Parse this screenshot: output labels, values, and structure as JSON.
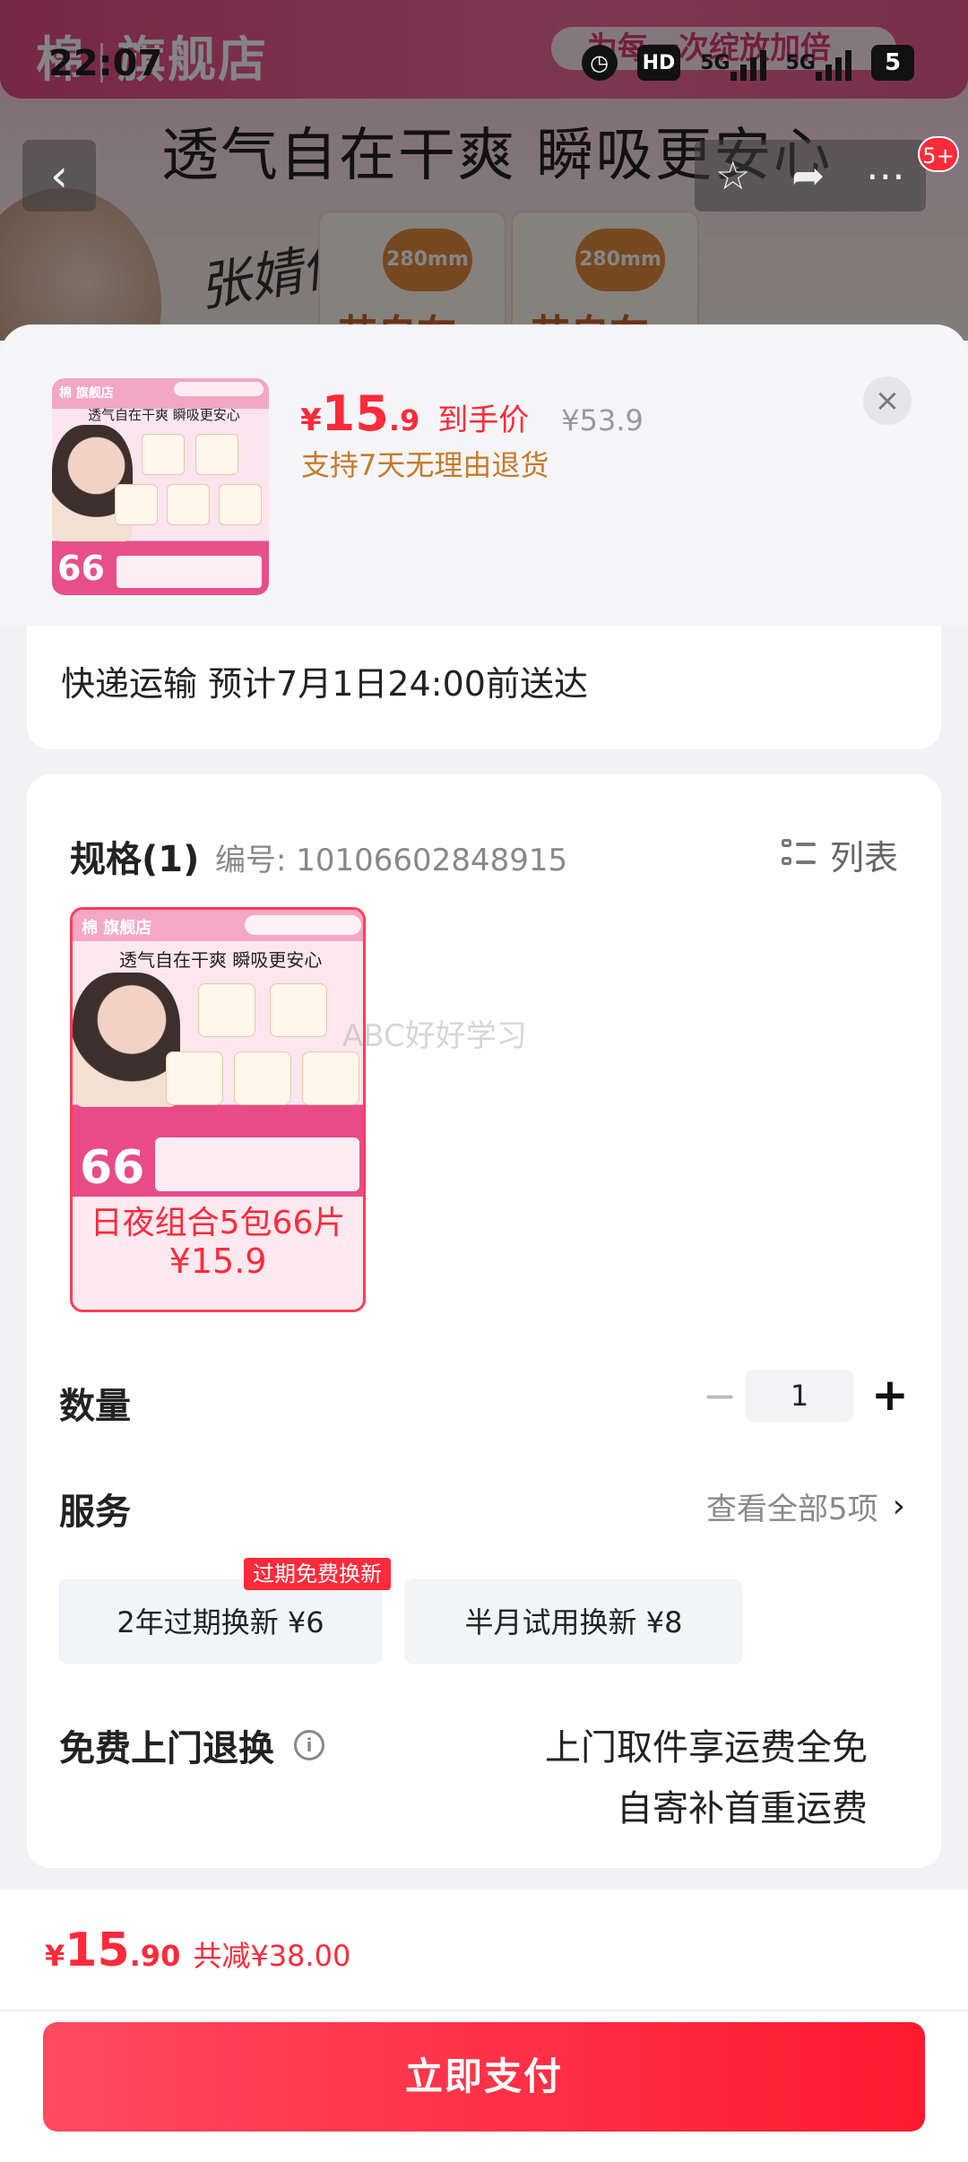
{
  "status_bar": {
    "time": "22:07",
    "icons": [
      "alarm-icon",
      "hd-icon",
      "signal-5g-icon",
      "signal-5g-icon",
      "battery-icon"
    ],
    "hd": "HD",
    "net1": "5G",
    "net2": "5G",
    "battery": "5"
  },
  "background_page": {
    "brand": "棉",
    "store": "旗舰店",
    "headline": "透气自在干爽 瞬吸更安心",
    "promo_text": "为每一次绽放加倍",
    "signature": "张婧仪",
    "box_tag": "280mm",
    "box_name": "芯自在",
    "cart_badge": "5+"
  },
  "sheet": {
    "close_icon": "×",
    "product": {
      "thumb_brand": "棉 旗舰店",
      "thumb_headline": "透气自在干爽 瞬吸更安心",
      "thumb_count": "66",
      "currency": "¥",
      "price_int": "15",
      "price_dec": ".9",
      "price_label": "到手价",
      "original_price": "¥53.9",
      "return_note": "支持7天无理由退货"
    },
    "delivery": {
      "text": "快递运输 预计7月1日24:00前送达"
    },
    "spec": {
      "title": "规格(1)",
      "code": "编号: 10106602848915",
      "list_view_label": "列表",
      "item": {
        "brand": "棉 旗舰店",
        "headline": "透气自在干爽 瞬吸更安心",
        "count": "66",
        "label": "日夜组合5包66片",
        "price": "¥15.9"
      },
      "watermark": "ABC好好学习"
    },
    "quantity": {
      "label": "数量",
      "minus": "−",
      "value": "1",
      "plus": "+"
    },
    "service": {
      "label": "服务",
      "view_all": "查看全部5项",
      "chevron": "›",
      "options": [
        {
          "label": "2年过期换新  ¥6",
          "badge": "过期免费换新"
        },
        {
          "label": "半月试用换新  ¥8"
        }
      ]
    },
    "free_return": {
      "label": "免费上门退换",
      "info_icon": "i",
      "lines": [
        "上门取件享运费全免",
        "自寄补首重运费"
      ]
    }
  },
  "footer": {
    "currency": "¥",
    "price_int": "15",
    "price_dec": ".90",
    "saved": "共减¥38.00",
    "pay_button": "立即支付"
  },
  "colors": {
    "accent": "#ff2a3a",
    "orange_note": "#c77a2c",
    "brand_pink": "#e54b86"
  }
}
